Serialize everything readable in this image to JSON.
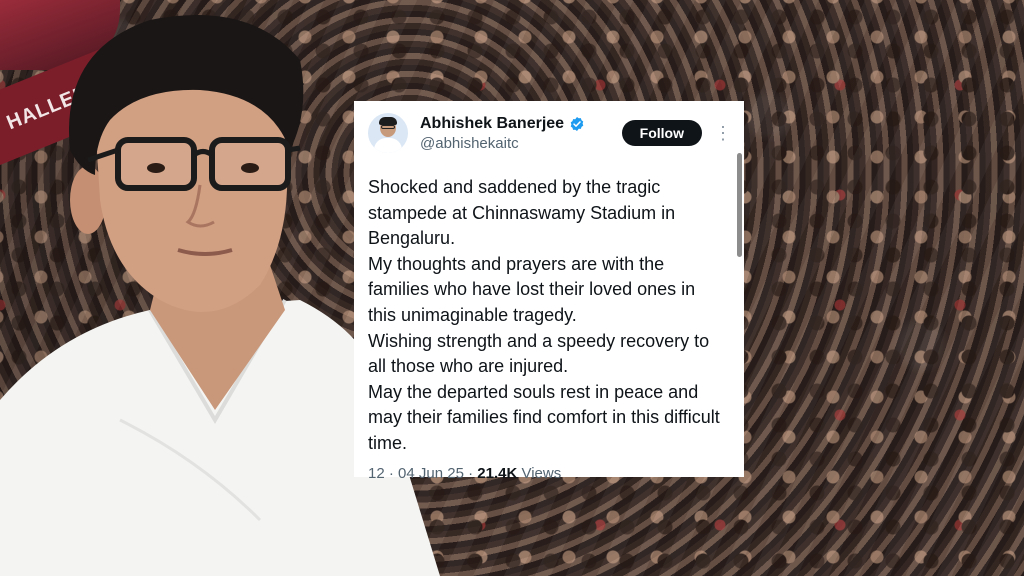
{
  "background": {
    "banner_text": "HALLENGER"
  },
  "tweet": {
    "author_name": "Abhishek Banerjee",
    "handle": "@abhishekaitc",
    "follow_label": "Follow",
    "more_icon": "⋮",
    "body": "Shocked and saddened by the tragic stampede at Chinnaswamy Stadium in Bengaluru.\nMy thoughts and prayers are with the families who have lost their loved ones in this unimaginable tragedy.\nWishing strength and a speedy recovery to all those who are injured.\nMay the departed souls rest in peace and may their families find comfort in this difficult time.",
    "time_fragment": "12",
    "date": "04 Jun 25",
    "views_count": "21.4K",
    "views_label": "Views",
    "verified_color": "#1d9bf0"
  }
}
